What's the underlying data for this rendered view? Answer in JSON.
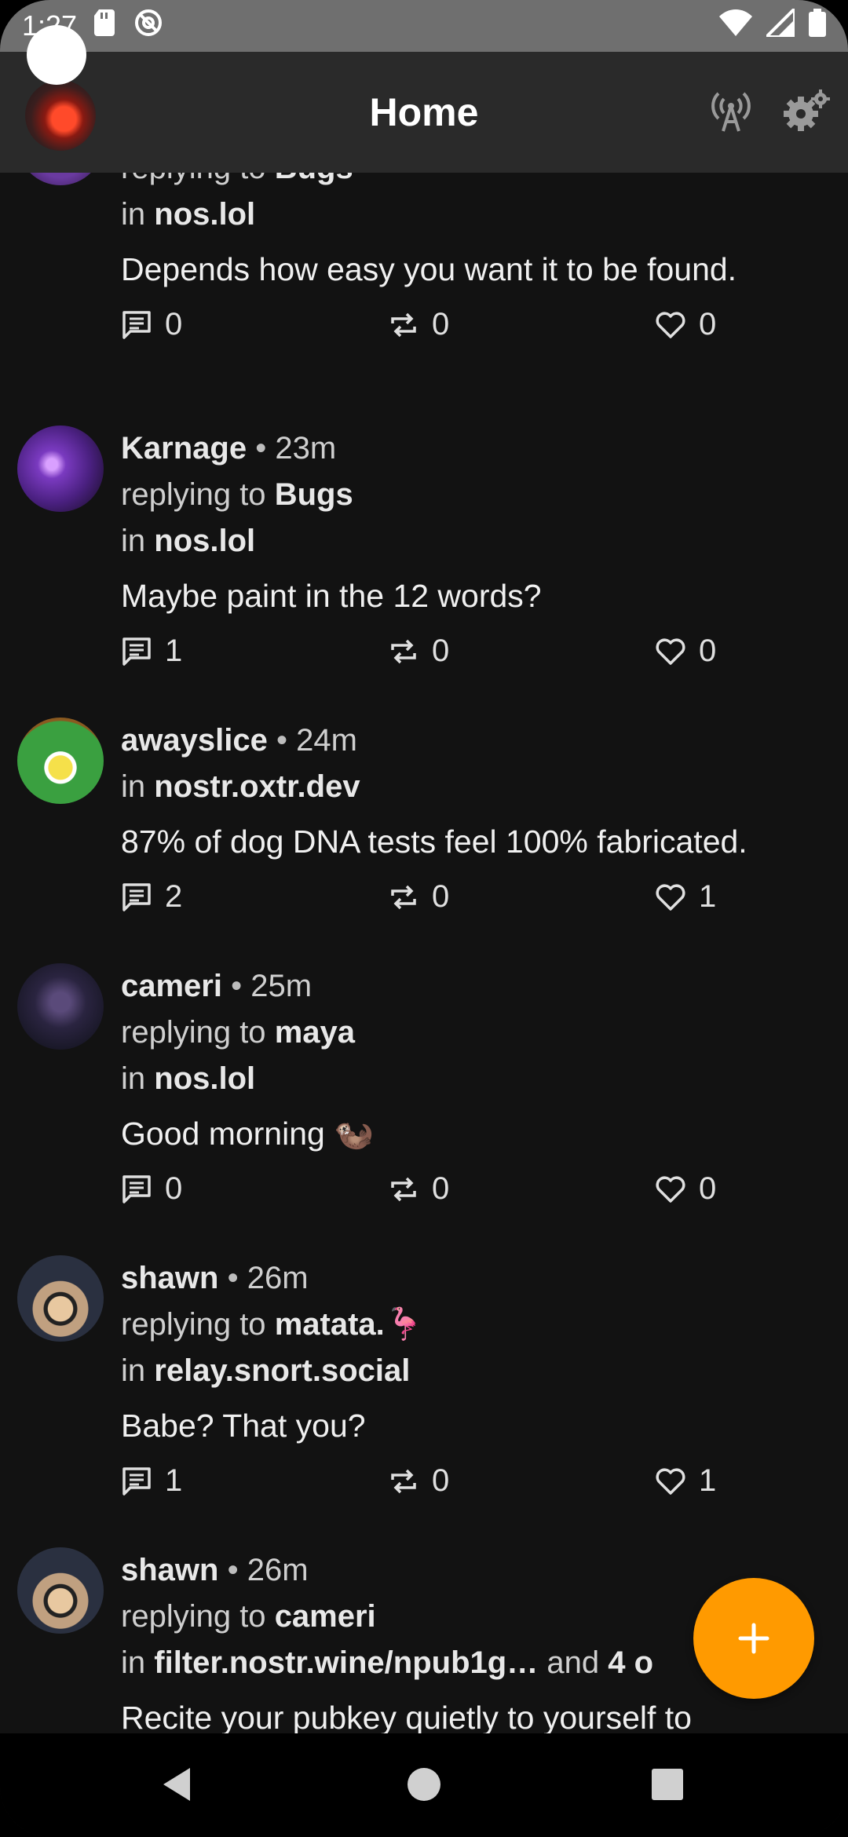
{
  "status_bar": {
    "time": "1:27"
  },
  "header": {
    "title": "Home"
  },
  "labels": {
    "replying_to": "replying to",
    "in": "in",
    "bullet": "•",
    "and": "and"
  },
  "posts": [
    {
      "author": "",
      "replying_to": "Bugs",
      "relay": "nos.lol",
      "content": "Depends how easy you want it to be found.",
      "replies": "0",
      "reposts": "0",
      "likes": "0"
    },
    {
      "author": "Karnage",
      "time": "23m",
      "replying_to": "Bugs",
      "relay": "nos.lol",
      "content": "Maybe paint in the 12 words?",
      "replies": "1",
      "reposts": "0",
      "likes": "0"
    },
    {
      "author": "awayslice",
      "time": "24m",
      "relay": "nostr.oxtr.dev",
      "content": "87% of dog DNA tests feel 100% fabricated.",
      "replies": "2",
      "reposts": "0",
      "likes": "1"
    },
    {
      "author": "cameri",
      "time": "25m",
      "replying_to": "maya",
      "relay": "nos.lol",
      "content": "Good morning 🦦",
      "replies": "0",
      "reposts": "0",
      "likes": "0"
    },
    {
      "author": "shawn",
      "time": "26m",
      "replying_to": "matata.🦩",
      "relay": "relay.snort.social",
      "content": "Babe? That you?",
      "replies": "1",
      "reposts": "0",
      "likes": "1"
    },
    {
      "author": "shawn",
      "time": "26m",
      "replying_to": "cameri",
      "relay": "filter.nostr.wine/npub1g…",
      "relay_more": "4 o",
      "content": "Recite your pubkey quietly to yourself to"
    }
  ],
  "colors": {
    "accent": "#ff9a00",
    "background": "#121212",
    "topbar": "#2a2a2a"
  }
}
